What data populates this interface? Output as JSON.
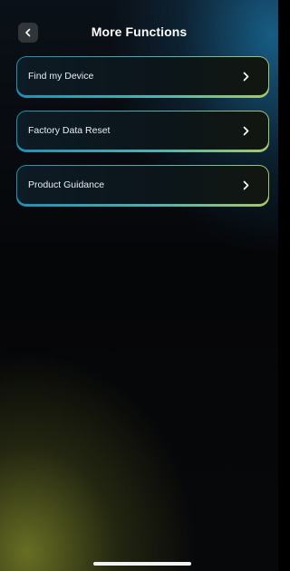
{
  "header": {
    "title": "More Functions",
    "back_icon": "chevron-left-icon"
  },
  "menu": {
    "items": [
      {
        "label": "Find my Device",
        "icon": "chevron-right-icon"
      },
      {
        "label": "Factory Data Reset",
        "icon": "chevron-right-icon"
      },
      {
        "label": "Product Guidance",
        "icon": "chevron-right-icon"
      }
    ]
  },
  "colors": {
    "border_start": "#1f8fb5",
    "border_end": "#a7c96a",
    "glow_top": "#1c76aa",
    "glow_bottom": "#787f28"
  }
}
